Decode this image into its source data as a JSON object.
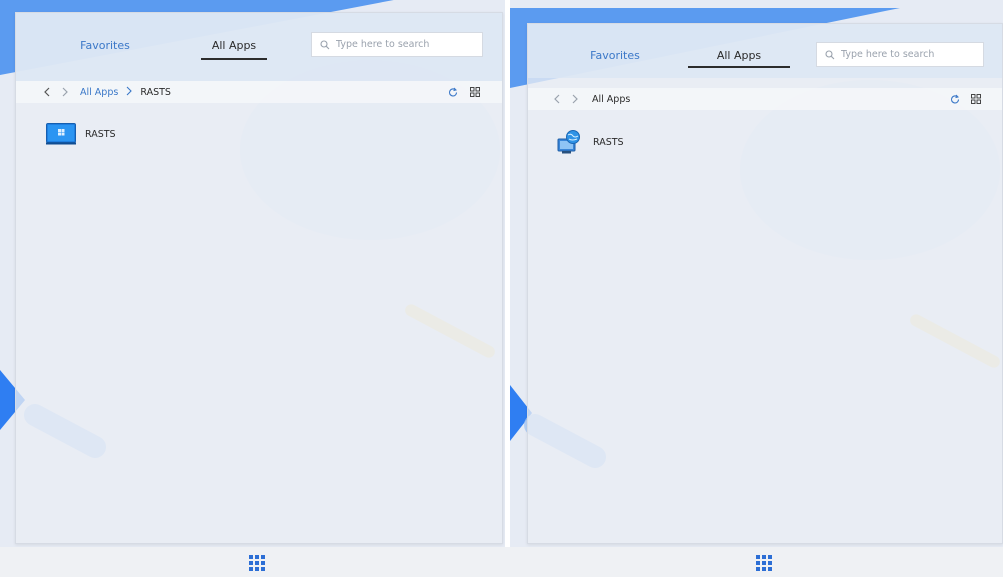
{
  "left": {
    "tabs": {
      "favorites": "Favorites",
      "all_apps": "All Apps"
    },
    "search": {
      "placeholder": "Type here to search"
    },
    "breadcrumb": {
      "root": "All Apps",
      "separator": ">",
      "current": "RASTS"
    },
    "items": [
      {
        "label": "RASTS",
        "icon": "windows-monitor-icon"
      }
    ]
  },
  "right": {
    "tabs": {
      "favorites": "Favorites",
      "all_apps": "All Apps"
    },
    "search": {
      "placeholder": "Type here to search"
    },
    "breadcrumb": {
      "root": "All Apps"
    },
    "items": [
      {
        "label": "RASTS",
        "icon": "globe-computer-icon"
      }
    ]
  },
  "colors": {
    "accent": "#3b78c8",
    "launcher": "#2c6ed5",
    "wallpaper_blue": "#4b8ff0",
    "wallpaper_yellow": "#f3e3a8"
  }
}
